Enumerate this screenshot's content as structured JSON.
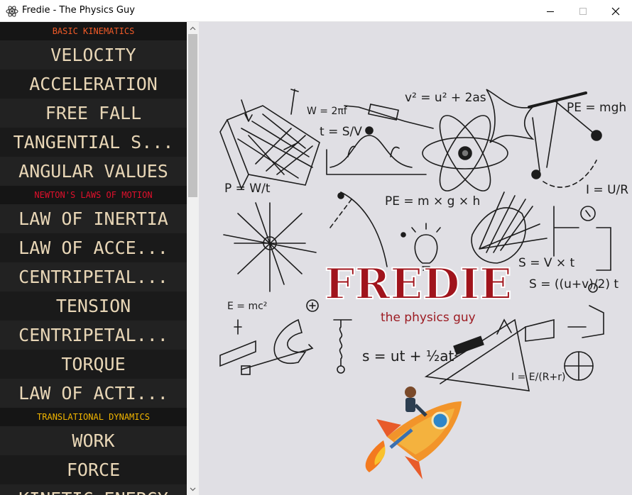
{
  "window": {
    "title": "Fredie - The Physics Guy"
  },
  "sidebar": {
    "sections": [
      {
        "title": "BASIC KINEMATICS",
        "color": "#f05a28",
        "items": [
          "VELOCITY",
          "ACCELERATION",
          "FREE FALL",
          "TANGENTIAL S...",
          "ANGULAR VALUES"
        ]
      },
      {
        "title": "NEWTON'S LAWS OF MOTION",
        "color": "#e0102c",
        "items": [
          "LAW OF INERTIA",
          "LAW OF ACCE...",
          "CENTRIPETAL...",
          "TENSION",
          "CENTRIPETAL...",
          "TORQUE",
          "LAW OF ACTI..."
        ]
      },
      {
        "title": "TRANSLATIONAL DYNAMICS",
        "color": "#f0b400",
        "items": [
          "WORK",
          "FORCE",
          "KINETIC ENERGY"
        ]
      }
    ]
  },
  "hero": {
    "logo": "FREDIE",
    "tagline": "the physics guy",
    "formulas": {
      "f1": "v² = u² + 2as",
      "f2": "PE = mgh",
      "f3": "W = 2πf",
      "f4": "t = S/V",
      "f5": "P = W/t",
      "f6": "PE = m × g × h",
      "f7": "I = U/R",
      "f8": "S = V × t",
      "f9": "S = ((u+v)/2) t",
      "f10": "E = mc²",
      "f11": "s = ut + ½at²",
      "f12": "I = E/(R+r)"
    }
  },
  "colors": {
    "sidebar_bg": "#1b1b1b",
    "item_text": "#e8d6b6",
    "main_bg": "#e0dfe4",
    "logo_red": "#a0141c"
  }
}
